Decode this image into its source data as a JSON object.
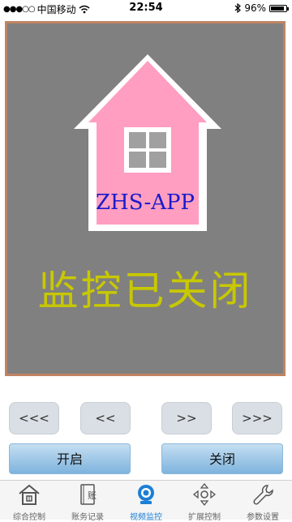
{
  "status_bar": {
    "carrier": "中国移动",
    "time": "22:54",
    "battery": "96%"
  },
  "video": {
    "logo_text": "ZHS-APP",
    "status_text": "监控已关闭"
  },
  "controls": {
    "arrows": [
      "<<<",
      "<<",
      ">>",
      ">>>"
    ],
    "open_label": "开启",
    "close_label": "关闭"
  },
  "tabs": [
    {
      "label": "综合控制",
      "icon": "home-icon"
    },
    {
      "label": "账务记录",
      "icon": "ledger-icon"
    },
    {
      "label": "视频监控",
      "icon": "camera-icon"
    },
    {
      "label": "扩展控制",
      "icon": "move-arrows-icon"
    },
    {
      "label": "参数设置",
      "icon": "wrench-icon"
    }
  ],
  "colors": {
    "accent": "#1c7fd6",
    "status_text": "#c8c800",
    "video_bg": "#808080",
    "frame": "#c08462",
    "house_pink": "#ff9ec0"
  }
}
